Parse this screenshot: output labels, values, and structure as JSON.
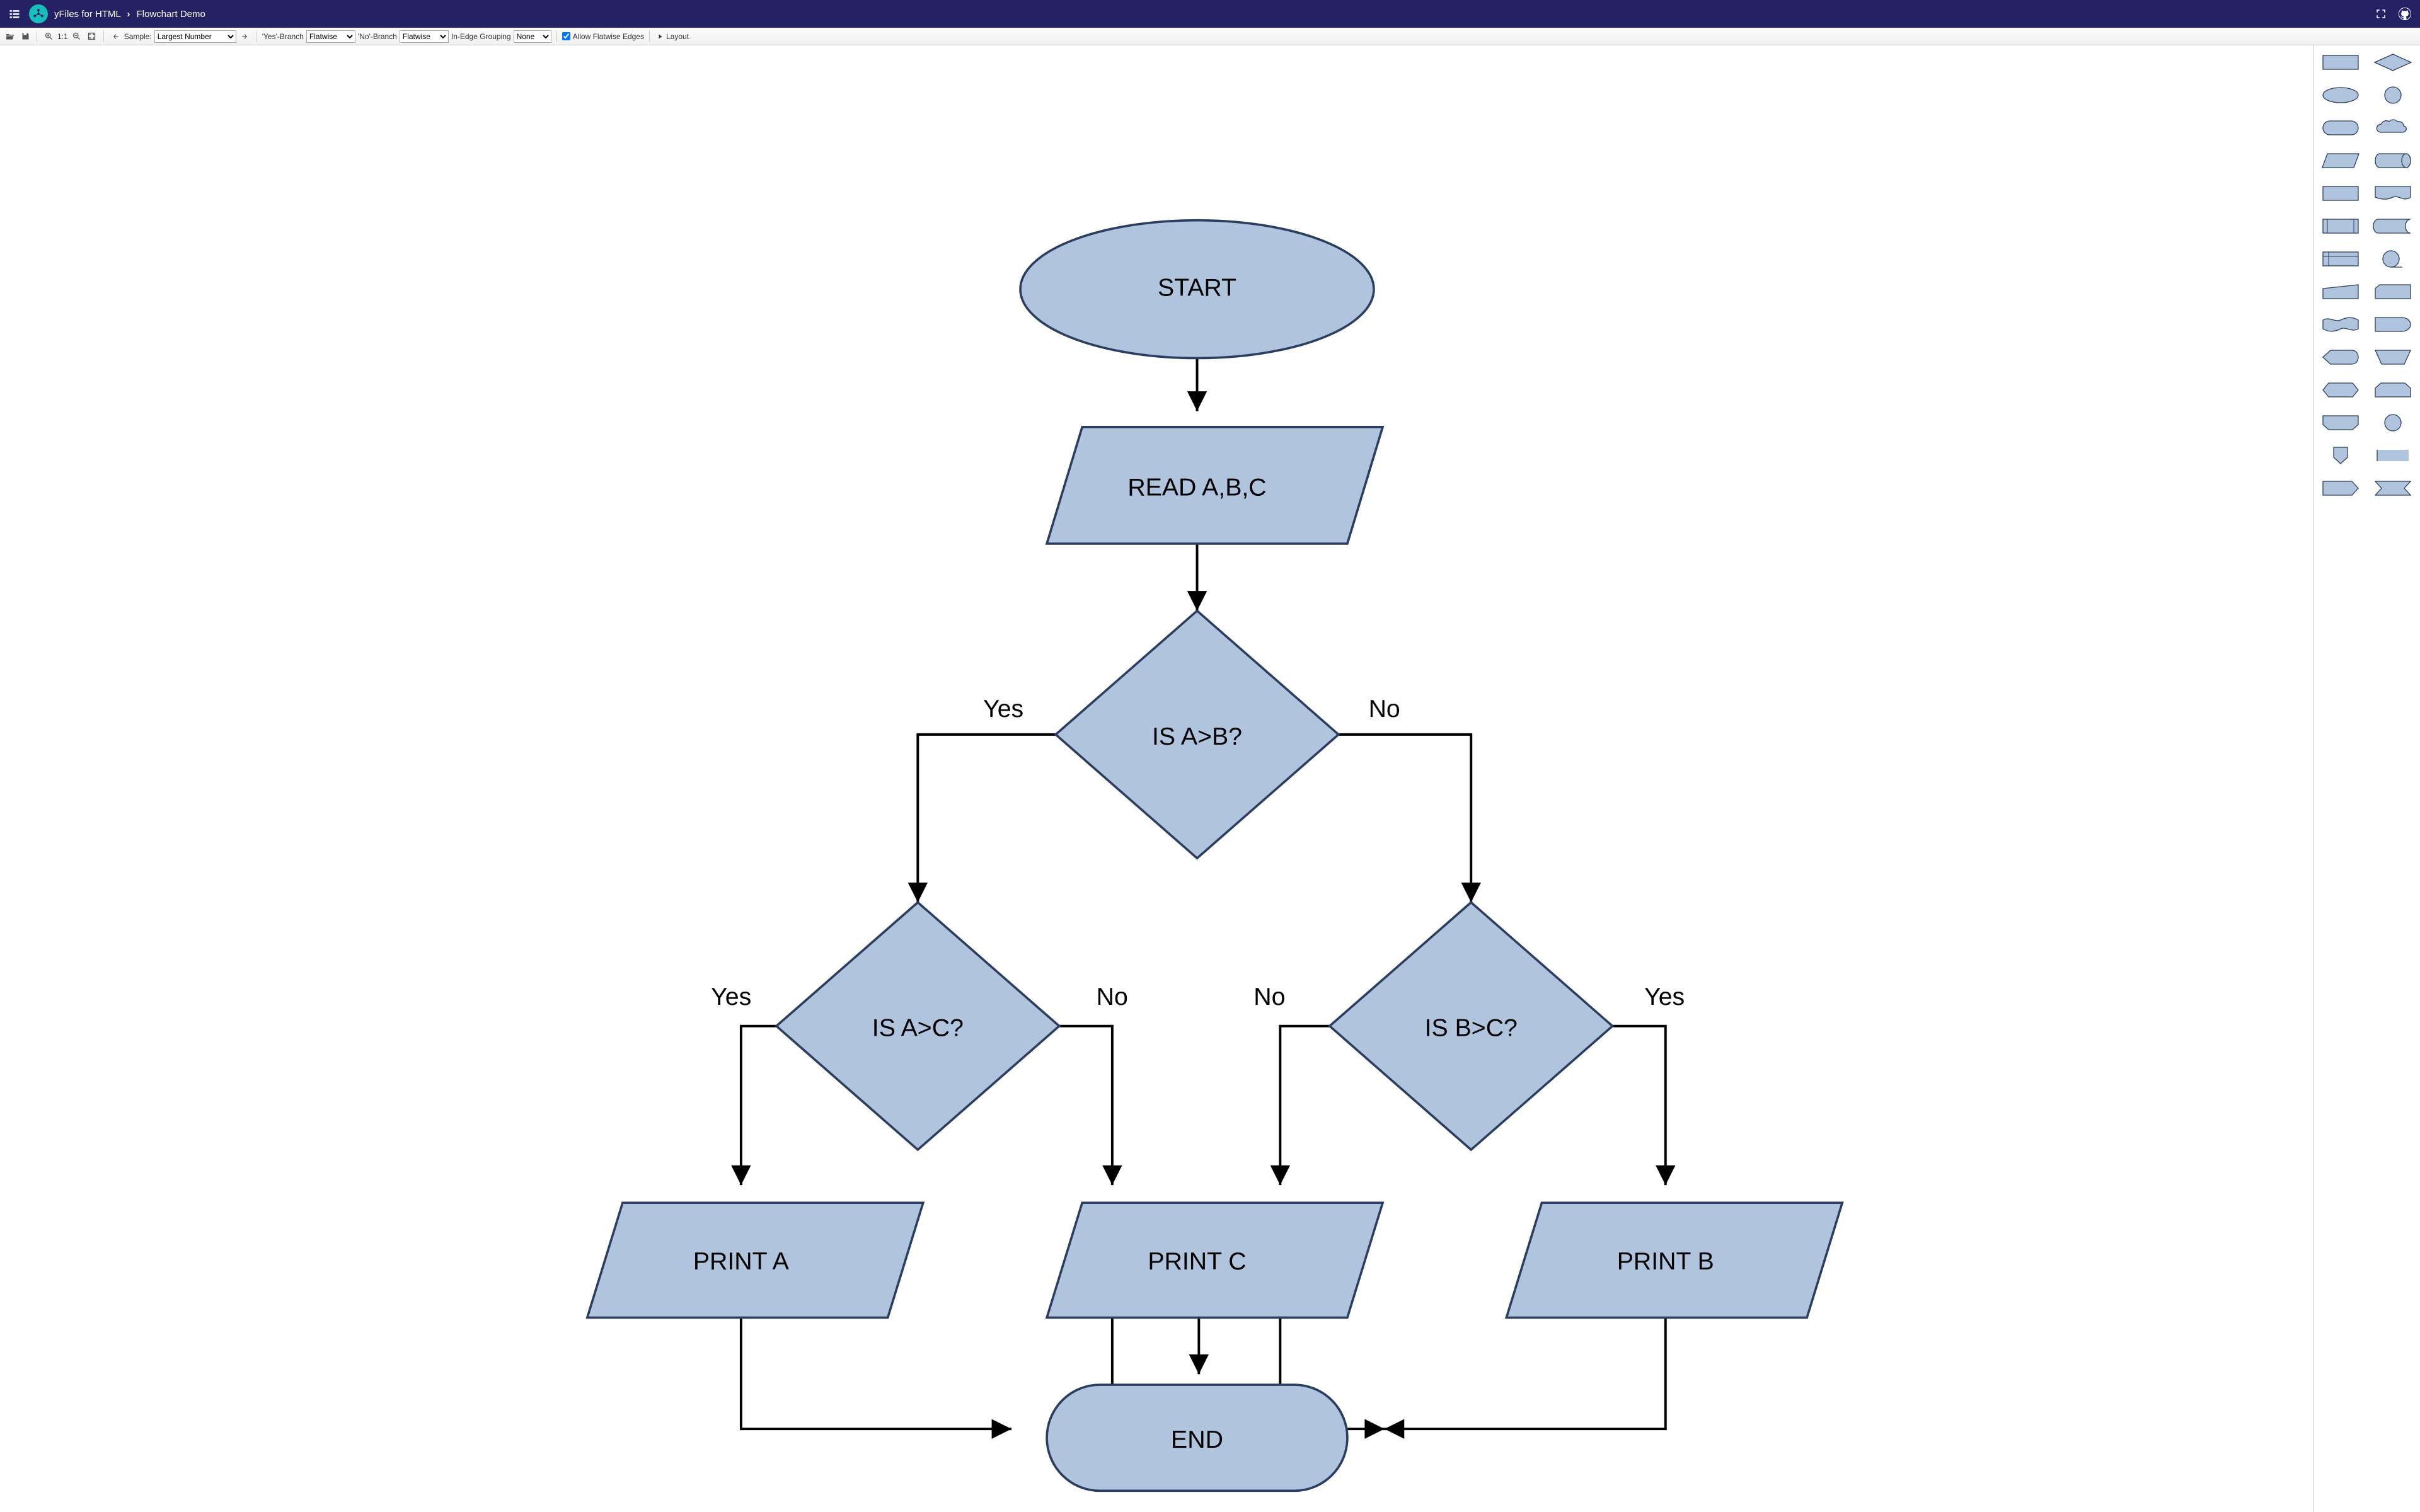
{
  "header": {
    "app_name": "yFiles for HTML",
    "demo_name": "Flowchart Demo"
  },
  "toolbar": {
    "zoom_label": "1:1",
    "sample_label": "Sample:",
    "sample_value": "Largest Number",
    "yes_branch_label": "'Yes'-Branch",
    "yes_branch_value": "Flatwise",
    "no_branch_label": "'No'-Branch",
    "no_branch_value": "Flatwise",
    "inedge_label": "In-Edge Grouping",
    "inedge_value": "None",
    "allow_flatwise_label": "Allow Flatwise Edges",
    "layout_label": "Layout"
  },
  "nodes": {
    "start": "START",
    "read": "READ A,B,C",
    "is_ab": "IS A>B?",
    "is_ac": "IS A>C?",
    "is_bc": "IS B>C?",
    "print_a": "PRINT A",
    "print_b": "PRINT B",
    "print_c": "PRINT C",
    "end": "END"
  },
  "edge_labels": {
    "yes": "Yes",
    "no": "No"
  },
  "palette": {
    "shapes": [
      "process",
      "decision",
      "start",
      "start2",
      "terminator",
      "cloud",
      "data",
      "directdata",
      "document",
      "document2",
      "predefined",
      "storeddata",
      "internalstorage",
      "sequentialdata",
      "manualinput",
      "card",
      "papertape",
      "delay",
      "display",
      "manualop",
      "preparation",
      "loopstart",
      "loopend",
      "offpageref",
      "annotation",
      "usermsg",
      "networkmsg",
      "terminator2"
    ]
  }
}
